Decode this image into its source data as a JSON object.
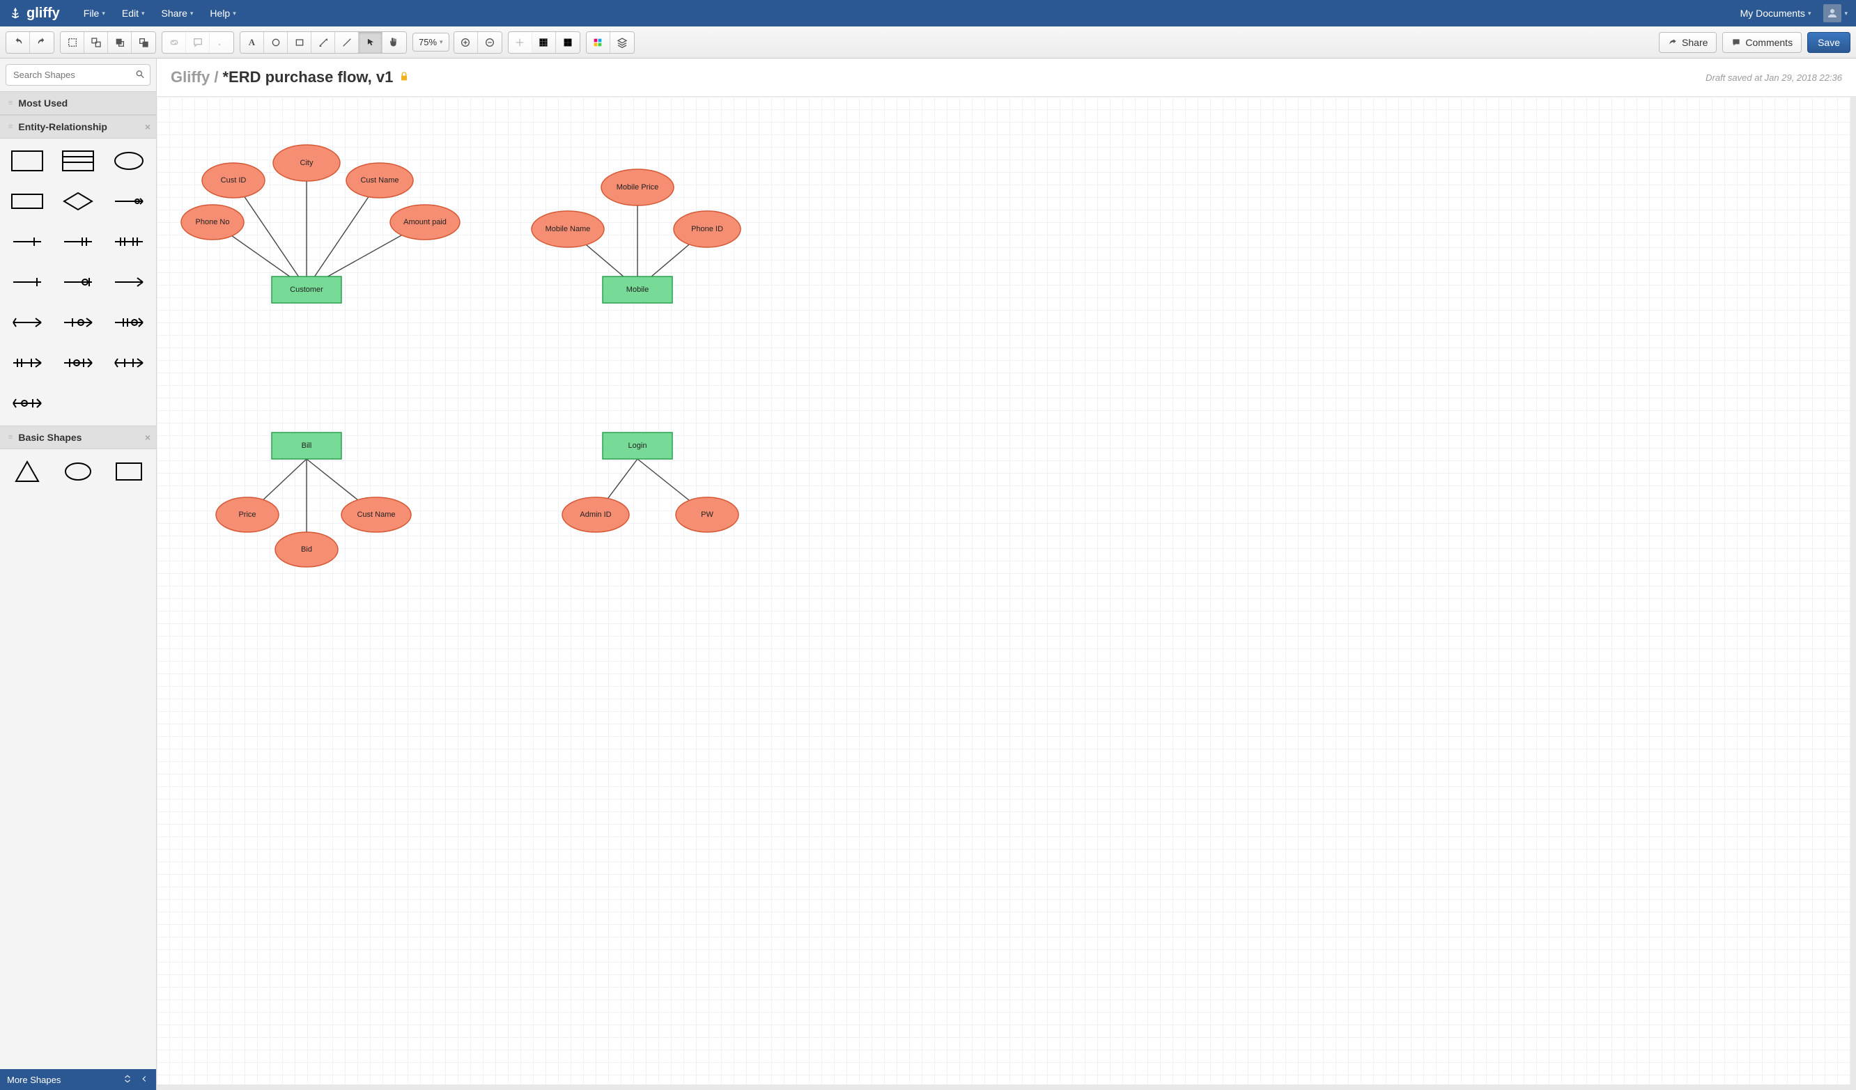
{
  "app": {
    "name": "gliffy"
  },
  "menu": {
    "file": "File",
    "edit": "Edit",
    "share": "Share",
    "help": "Help",
    "my_documents": "My Documents"
  },
  "toolbar": {
    "zoom": "75%",
    "share": "Share",
    "comments": "Comments",
    "save": "Save"
  },
  "sidebar": {
    "search_placeholder": "Search Shapes",
    "sections": {
      "most_used": "Most Used",
      "entity_relationship": "Entity-Relationship",
      "basic_shapes": "Basic Shapes"
    },
    "footer": {
      "more_shapes": "More Shapes"
    }
  },
  "doc": {
    "breadcrumb": "Gliffy /",
    "title": "*ERD purchase flow, v1",
    "status": "Draft saved at Jan 29, 2018 22:36"
  },
  "diagram": {
    "entities": {
      "customer": "Customer",
      "mobile": "Mobile",
      "bill": "Bill",
      "login": "Login"
    },
    "attributes": {
      "phone_no": "Phone No",
      "cust_id": "Cust ID",
      "city": "City",
      "cust_name": "Cust Name",
      "amount_paid": "Amount paid",
      "mobile_name": "Mobile Name",
      "mobile_price": "Mobile Price",
      "phone_id": "Phone ID",
      "price": "Price",
      "bid": "Bid",
      "cust_name2": "Cust Name",
      "admin_id": "Admin ID",
      "pw": "PW"
    }
  }
}
